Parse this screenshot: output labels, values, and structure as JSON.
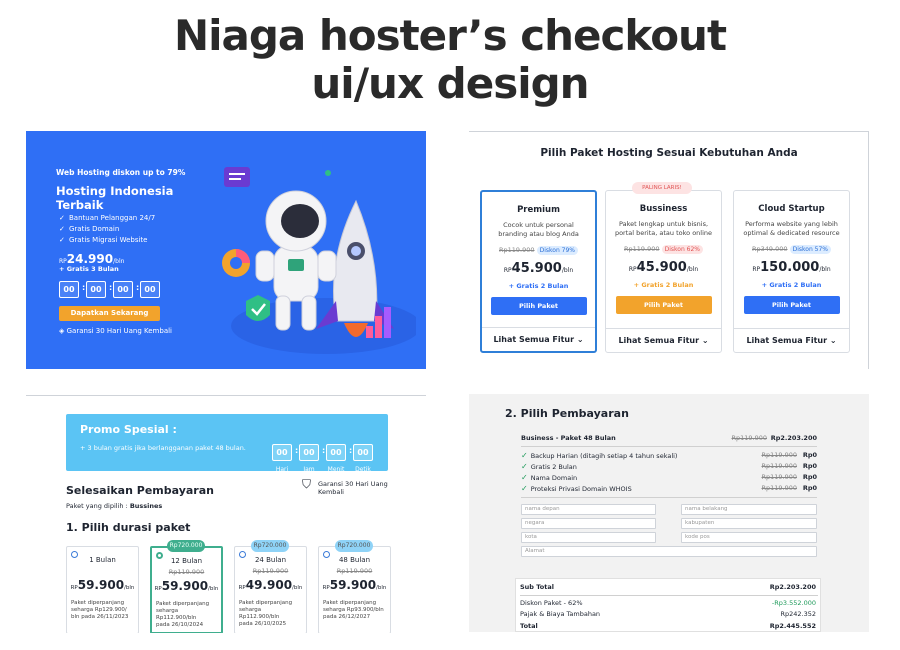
{
  "page": {
    "title_line1": "Niaga hoster’s checkout",
    "title_line2": "ui/ux design"
  },
  "hero": {
    "promo_tag": "Web Hosting diskon up to 79%",
    "headline_line1": "Hosting Indonesia",
    "headline_line2": "Terbaik",
    "benefits": [
      "Bantuan Pelanggan 24/7",
      "Gratis Domain",
      "Gratis Migrasi Website"
    ],
    "price_prefix": "RP",
    "price": "24.990",
    "price_suffix": "/bln",
    "bonus": "+ Gratis 3 Bulan",
    "countdown": [
      "00",
      "00",
      "00",
      "00"
    ],
    "cta": "Dapatkan Sekarang",
    "guarantee": "Garansi 30 Hari Uang Kembali",
    "bg_color": "#2f6ff5"
  },
  "packages": {
    "heading": "Pilih Paket Hosting Sesuai Kebutuhan Anda",
    "popular_badge": "PALING LARIS!",
    "items": [
      {
        "name": "Premium",
        "desc": "Cocok untuk personal branding atau blog Anda",
        "old": "Rp119.900",
        "discount": "Diskon 79%",
        "prefix": "RP",
        "price": "45.900",
        "suffix": "/bln",
        "bonus": "+ Gratis 2 Bulan",
        "button": "Pilih Paket",
        "features": "Lihat Semua Fitur"
      },
      {
        "name": "Bussiness",
        "desc": "Paket lengkap untuk bisnis, portal berita, atau toko online",
        "old": "Rp119.900",
        "discount": "Diskon 62%",
        "prefix": "RP",
        "price": "45.900",
        "suffix": "/bln",
        "bonus": "+ Gratis 2 Bulan",
        "button": "Pilih Paket",
        "features": "Lihat Semua Fitur"
      },
      {
        "name": "Cloud Startup",
        "desc": "Performa website yang lebih optimal & dedicated resource",
        "old": "Rp349.000",
        "discount": "Diskon 57%",
        "prefix": "RP",
        "price": "150.000",
        "suffix": "/bln",
        "bonus": "+ Gratis 2 Bulan",
        "button": "Pilih Paket",
        "features": "Lihat Semua Fitur"
      }
    ],
    "colors": {
      "primary": "#2f6ff5",
      "orange": "#f2a32c"
    }
  },
  "promo": {
    "title": "Promo Spesial :",
    "desc": "+ 3 bulan gratis jika berlangganan paket 48 bulan.",
    "countdown": [
      "00",
      "00",
      "00",
      "00"
    ],
    "labels": [
      "Hari",
      "Jam",
      "Menit",
      "Detik"
    ],
    "section_title": "Selesaikan Pembayaran",
    "chosen_label": "Paket yang dipilih : ",
    "chosen_value": "Bussines",
    "guarantee_line1": "Garansi 30 Hari Uang",
    "guarantee_line2": "Kembali",
    "duration_title": "1. Pilih durasi paket",
    "durations": [
      {
        "months": "1 Bulan",
        "ribbon": "",
        "old": "",
        "prefix": "RP",
        "price": "59.900",
        "suffix": "/bln",
        "note_line1": "Paket diperpanjang",
        "note_line2": "seharga Rp129.900/",
        "note_line3": "bln pada 26/11/2023"
      },
      {
        "months": "12 Bulan",
        "ribbon": "Rp720.000",
        "old": "Rp119.900",
        "prefix": "RP",
        "price": "59.900",
        "suffix": "/bln",
        "note_line1": "Paket diperpanjang",
        "note_line2": "seharga Rp112.900/bln",
        "note_line3": "pada 26/10/2024"
      },
      {
        "months": "24 Bulan",
        "ribbon": "Rp720.000",
        "old": "Rp119.900",
        "prefix": "RP",
        "price": "49.900",
        "suffix": "/bln",
        "note_line1": "Paket diperpanjang",
        "note_line2": "seharga Rp112.900/bln",
        "note_line3": "pada 26/10/2025"
      },
      {
        "months": "48 Bulan",
        "ribbon": "Rp720.000",
        "old": "Rp119.900",
        "prefix": "RP",
        "price": "59.900",
        "suffix": "/bln",
        "note_line1": "Paket diperpanjang",
        "note_line2": "seharga Rp93.900/bln",
        "note_line3": "pada 26/12/2027"
      }
    ]
  },
  "payment": {
    "title": "2. Pilih Pembayaran",
    "package_label": "Business - Paket 48 Bulan",
    "package_old": "Rp119.900",
    "package_price": "Rp2.203.200",
    "items": [
      {
        "label": "Backup Harian (ditagih setiap 4 tahun sekali)",
        "old": "Rp119.900",
        "price": "Rp0"
      },
      {
        "label": "Gratis 2 Bulan",
        "old": "Rp119.900",
        "price": "Rp0"
      },
      {
        "label": "Nama Domain",
        "old": "Rp119.900",
        "price": "Rp0"
      },
      {
        "label": "Proteksi Privasi Domain WHOIS",
        "old": "Rp119.900",
        "price": "Rp0"
      }
    ],
    "fields": {
      "first_name": "nama depan",
      "last_name": "nama belakang",
      "country": "negara",
      "district": "kabupaten",
      "city": "kota",
      "postal": "kode pos",
      "address": "Alamat"
    },
    "subtotal_label": "Sub Total",
    "subtotal": "Rp2.203.200",
    "discount_label": "Diskon Paket - 62%",
    "discount": "-Rp3.552.000",
    "tax_label": "Pajak & Biaya Tambahan",
    "tax": "Rp242.352",
    "total_label": "Total",
    "total": "Rp2.445.552"
  }
}
